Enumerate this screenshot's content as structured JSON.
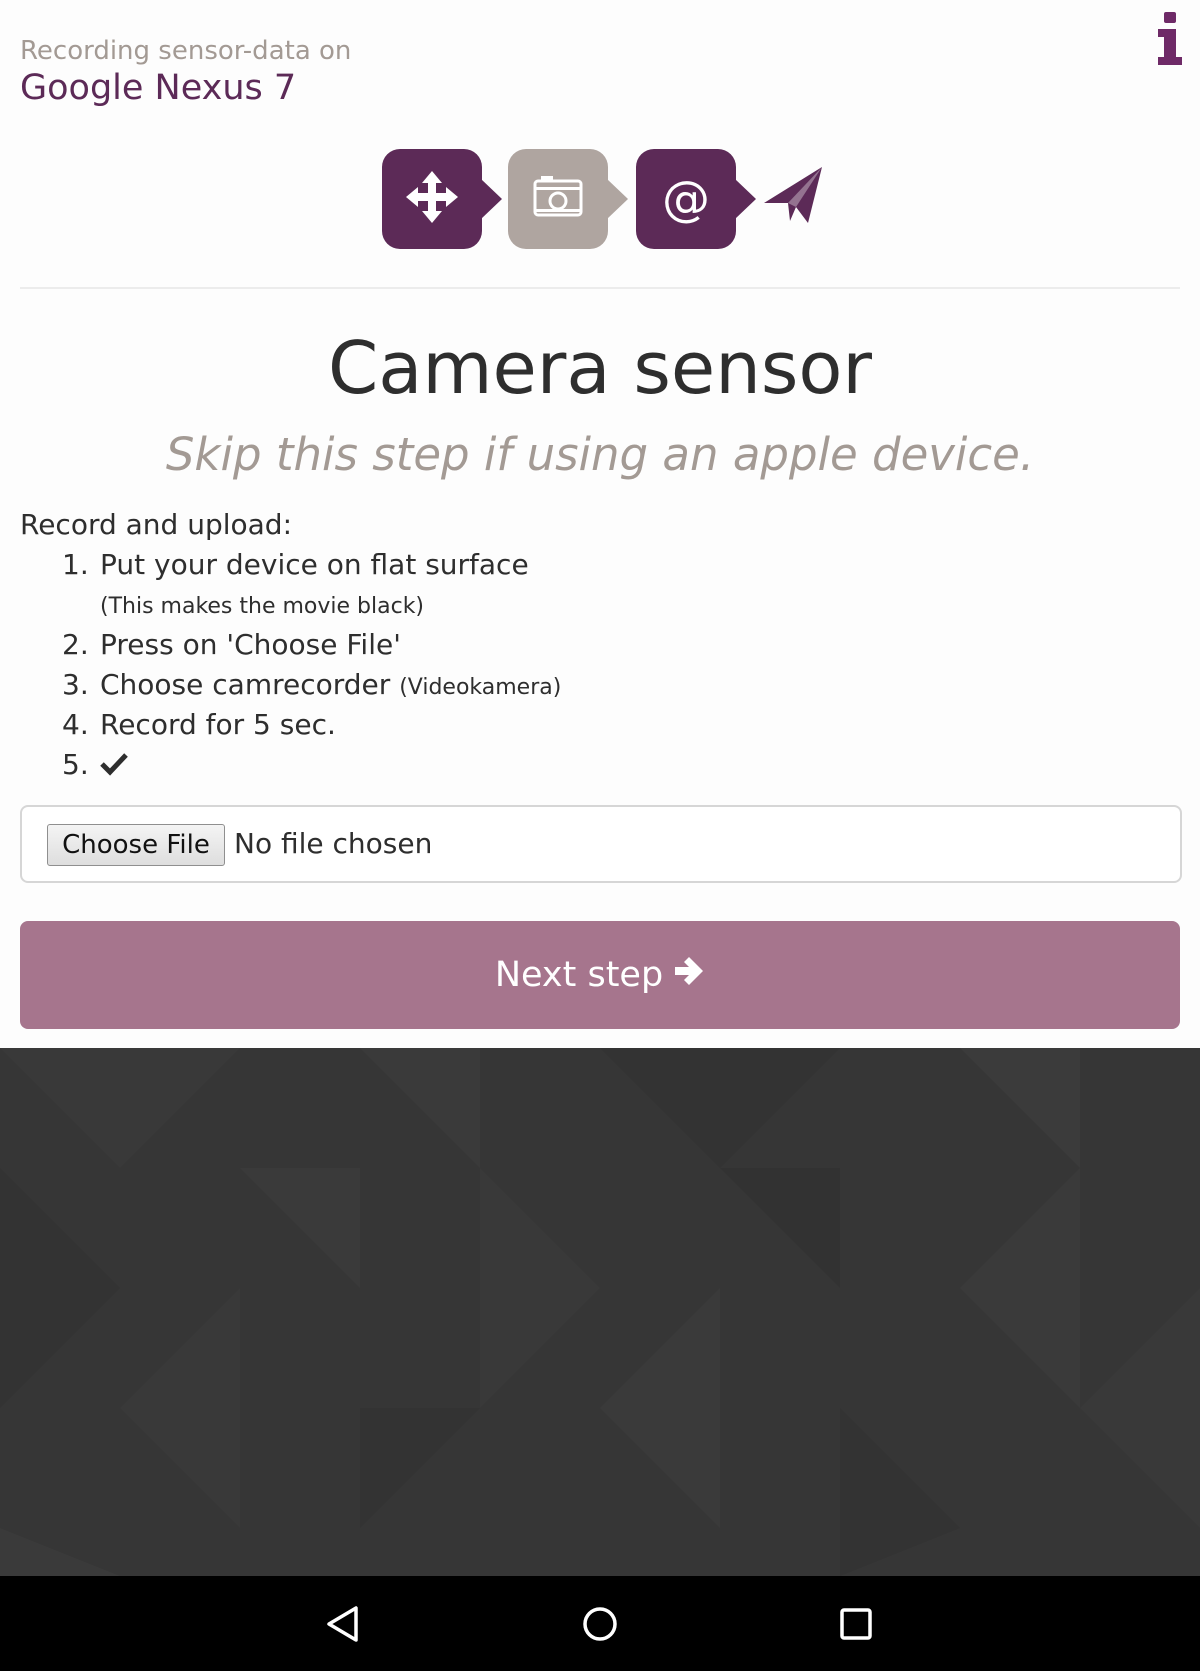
{
  "header": {
    "subtitle": "Recording sensor-data on",
    "device": "Google Nexus 7"
  },
  "steps": [
    {
      "icon": "move-arrows-icon",
      "state": "done"
    },
    {
      "icon": "camera-icon",
      "state": "current"
    },
    {
      "icon": "at-sign-icon",
      "state": "todo",
      "glyph": "@"
    },
    {
      "icon": "paper-plane-icon",
      "state": "final"
    }
  ],
  "content": {
    "title": "Camera sensor",
    "subtitle": "Skip this step if using an apple device.",
    "intro": "Record and upload:",
    "items": [
      {
        "num": "1.",
        "text": "Put your device on flat surface",
        "note": "(This makes the movie black)"
      },
      {
        "num": "2.",
        "text": "Press on 'Choose File'"
      },
      {
        "num": "3.",
        "text": "Choose camrecorder",
        "small": "(Videokamera)"
      },
      {
        "num": "4.",
        "text": "Record for 5 sec."
      },
      {
        "num": "5.",
        "icon": "checkmark-icon"
      }
    ]
  },
  "file_input": {
    "button_label": "Choose File",
    "status": "No file chosen"
  },
  "next_button": {
    "label": "Next step"
  },
  "colors": {
    "brand": "#5c2a57",
    "brand_light": "#a6758d",
    "muted": "#a39a94",
    "step_grey": "#afa5a0",
    "footer": "#363636"
  }
}
